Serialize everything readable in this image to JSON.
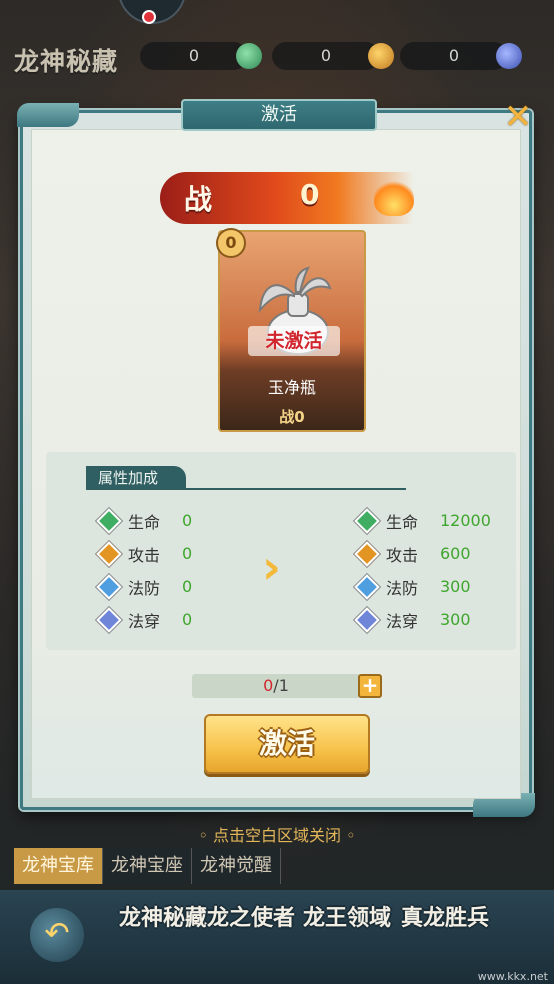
{
  "header": {
    "title": "龙神秘藏",
    "resources": [
      {
        "value": "0",
        "icon": "jade-icon"
      },
      {
        "value": "0",
        "icon": "gold-ingot-icon"
      },
      {
        "value": "0",
        "icon": "crystal-icon"
      }
    ]
  },
  "modal": {
    "title": "激活",
    "power": {
      "label": "战",
      "value": "0"
    },
    "card": {
      "badge": "0",
      "status": "未激活",
      "name": "玉净瓶",
      "power_label": "战0"
    },
    "attributes": {
      "header": "属性加成",
      "current": [
        {
          "name": "生命",
          "value": "0"
        },
        {
          "name": "攻击",
          "value": "0"
        },
        {
          "name": "法防",
          "value": "0"
        },
        {
          "name": "法穿",
          "value": "0"
        }
      ],
      "next": [
        {
          "name": "生命",
          "value": "12000"
        },
        {
          "name": "攻击",
          "value": "600"
        },
        {
          "name": "法防",
          "value": "300"
        },
        {
          "name": "法穿",
          "value": "300"
        }
      ]
    },
    "progress": {
      "current": "0",
      "separator": "/",
      "max": "1"
    },
    "activate_label": "激活"
  },
  "close_hint": "点击空白区域关闭",
  "bottom_tabs": [
    "龙神宝库",
    "龙神宝座",
    "龙神觉醒"
  ],
  "bottom_nav": [
    "龙神秘藏",
    "龙之使者",
    "龙王领域",
    "真龙胜兵"
  ],
  "watermark": "www.kkx.net"
}
